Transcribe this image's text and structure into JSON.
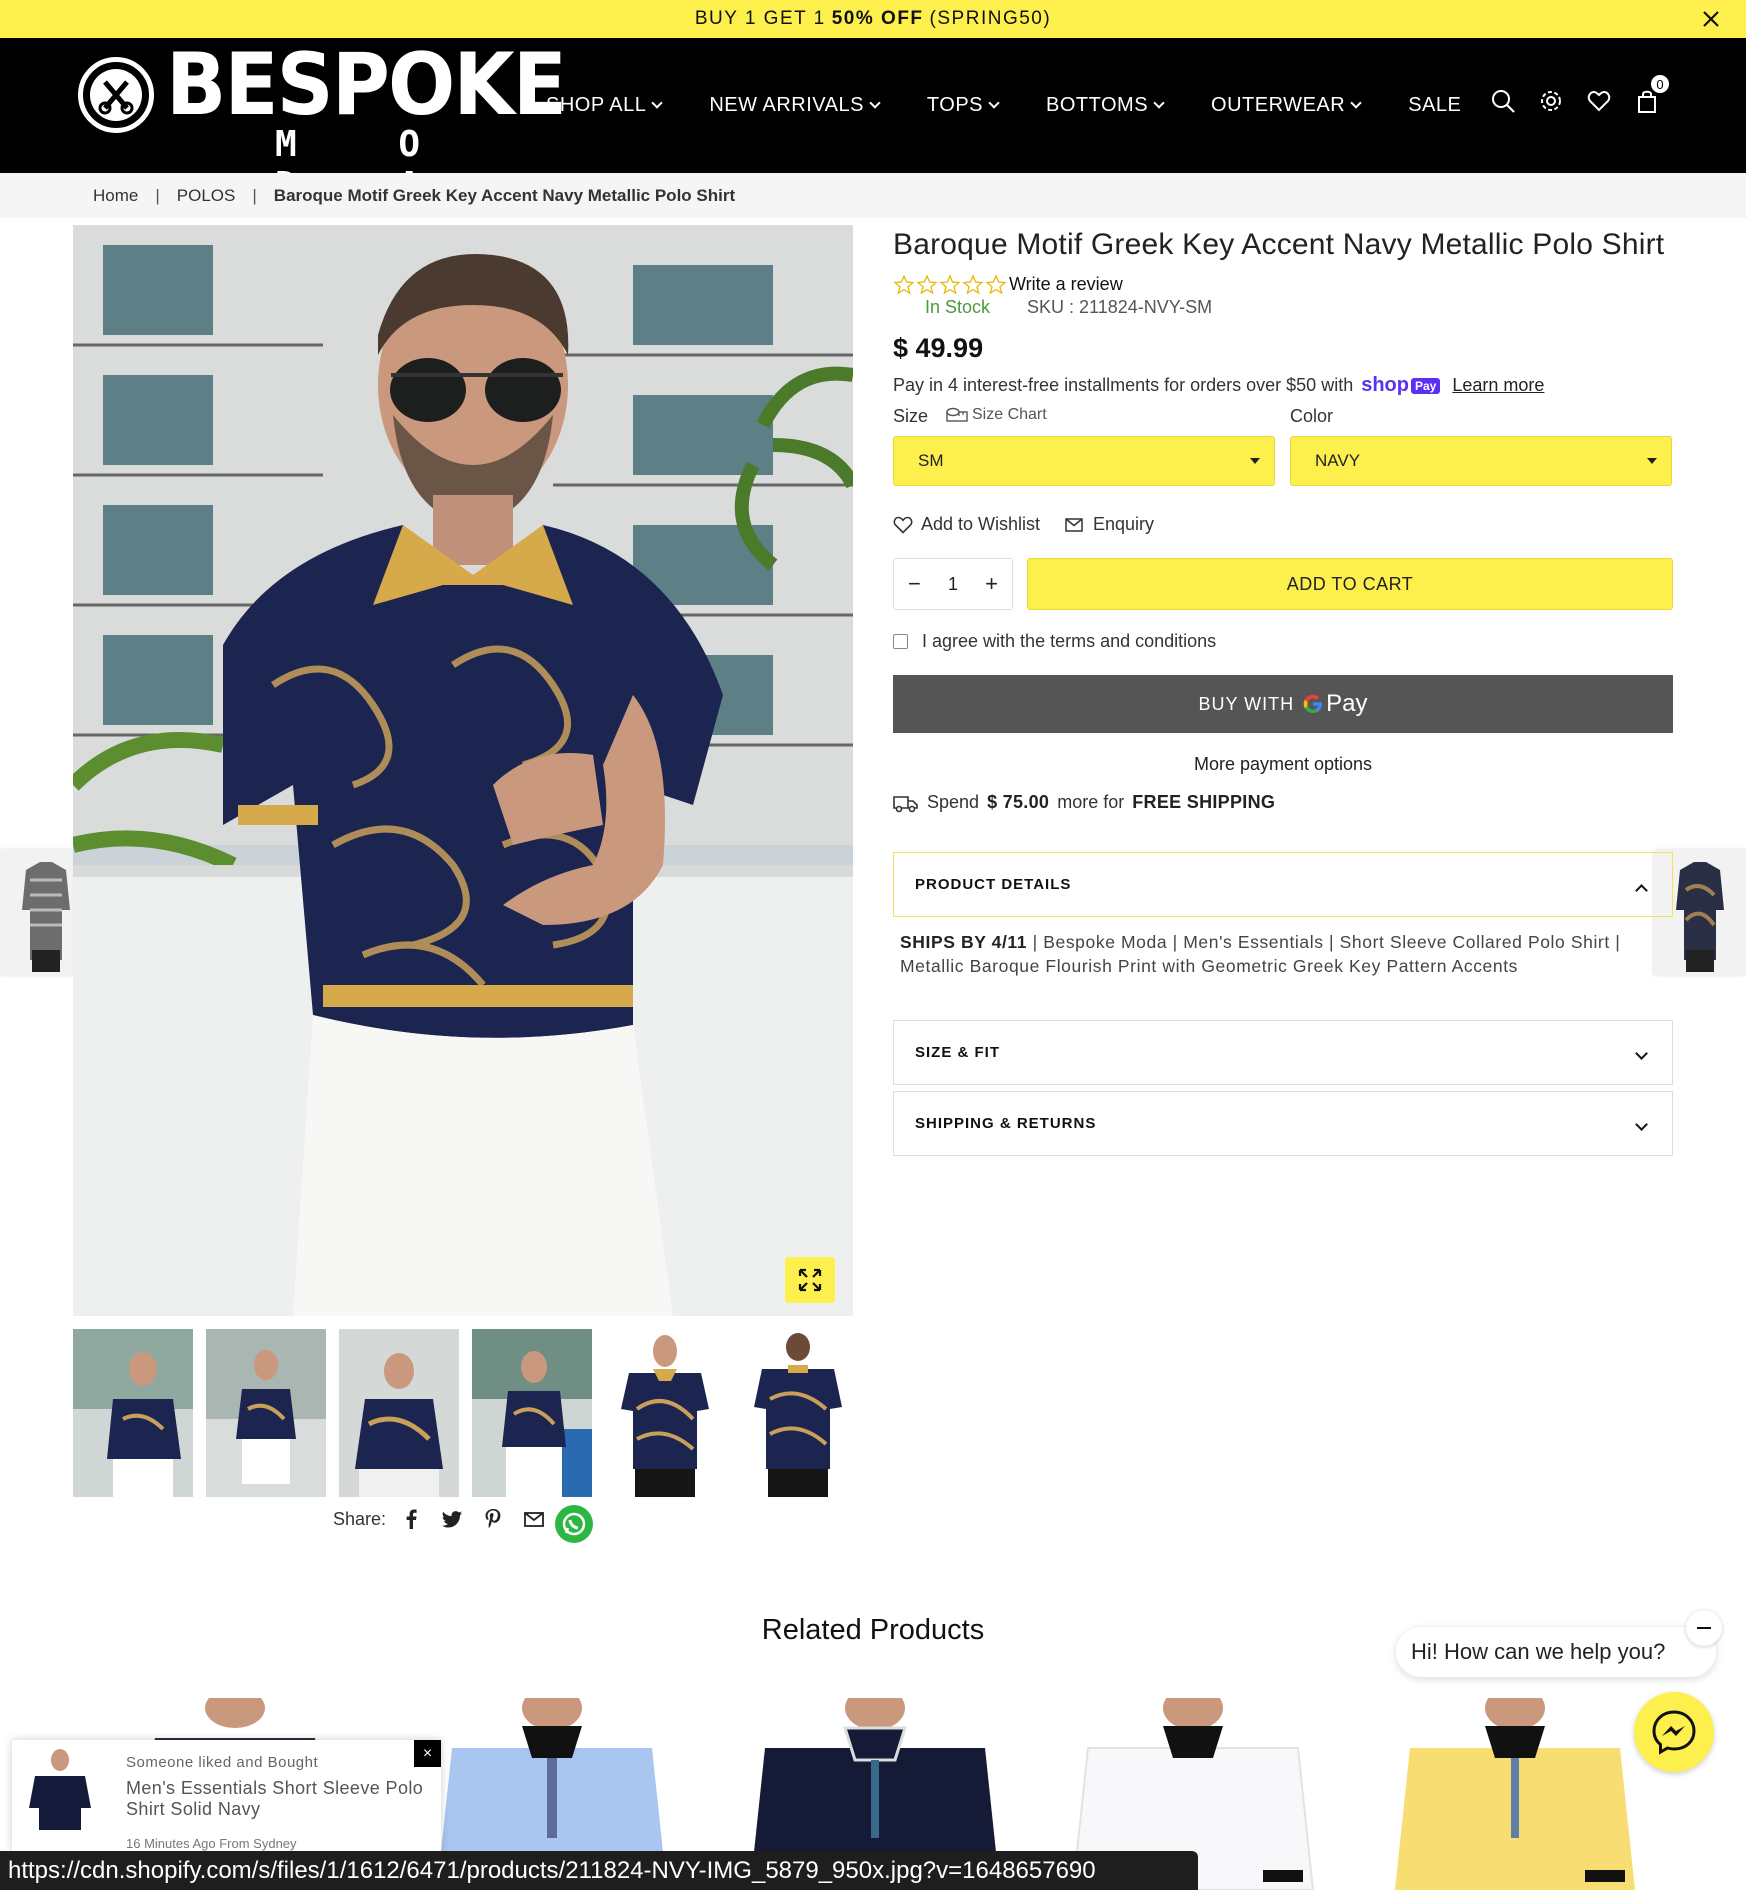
{
  "announcement": {
    "pre": "BUY 1 GET 1",
    "strong": "50% OFF",
    "post": "(SPRING50)"
  },
  "brand": {
    "name": "BESPOKE",
    "sub": "M O D A"
  },
  "nav": {
    "items": [
      "SHOP ALL",
      "NEW ARRIVALS",
      "TOPS",
      "BOTTOMS",
      "OUTERWEAR",
      "SALE"
    ],
    "cart_count": "0"
  },
  "breadcrumb": {
    "home": "Home",
    "category": "POLOS",
    "current": "Baroque Motif Greek Key Accent Navy Metallic Polo Shirt"
  },
  "product": {
    "title": "Baroque Motif Greek Key Accent Navy Metallic Polo Shirt",
    "review_link": "Write a review",
    "stock": "In Stock",
    "sku_label": "SKU :",
    "sku": "211824-NVY-SM",
    "price": "$ 49.99",
    "installments": "Pay in 4 interest-free installments for orders over $50 with",
    "shoppay": "shop",
    "shoppay_badge": "Pay",
    "learn_more": "Learn more",
    "size_label": "Size",
    "size_chart": "Size Chart",
    "color_label": "Color",
    "size_value": "SM",
    "color_value": "NAVY",
    "wishlist": "Add to Wishlist",
    "enquiry": "Enquiry",
    "quantity": "1",
    "add_to_cart": "ADD TO CART",
    "terms": "I agree with the terms and conditions",
    "buy_with": "BUY WITH",
    "gpay": "Pay",
    "more_payment": "More payment options",
    "shipping_pre": "Spend",
    "shipping_amount": "$ 75.00",
    "shipping_mid": "more for",
    "shipping_free": "FREE SHIPPING"
  },
  "accordions": {
    "details_title": "PRODUCT DETAILS",
    "details_ships": "SHIPS BY 4/11",
    "details_text": "| Bespoke Moda | Men's Essentials | Short Sleeve Collared Polo Shirt | Metallic Baroque Flourish Print with Geometric Greek Key Pattern Accents",
    "size_fit": "SIZE & FIT",
    "shipping_returns": "SHIPPING & RETURNS"
  },
  "share": {
    "label": "Share:"
  },
  "related": {
    "title": "Related Products"
  },
  "chat": {
    "bubble": "Hi! How can we help you?"
  },
  "popup": {
    "label": "Someone liked and Bought",
    "name": "Men's Essentials Short Sleeve Polo Shirt Solid Navy",
    "time": "16 Minutes Ago From Sydney",
    "close": "×"
  },
  "status_bar": {
    "url": "https://cdn.shopify.com/s/files/1/1612/6471/products/211824-NVY-IMG_5879_950x.jpg?v=1648657690"
  },
  "colors": {
    "accent": "#fdf04d",
    "header": "#000000",
    "stock": "#4a9b3a",
    "shoppay": "#5a31f4"
  },
  "icons": [
    "close-icon",
    "chevron-down-icon",
    "search-icon",
    "gear-icon",
    "heart-icon",
    "bag-icon",
    "ruler-icon",
    "mail-icon",
    "truck-icon",
    "expand-icon",
    "facebook-icon",
    "twitter-icon",
    "pinterest-icon",
    "whatsapp-icon",
    "messenger-icon",
    "star-icon"
  ]
}
